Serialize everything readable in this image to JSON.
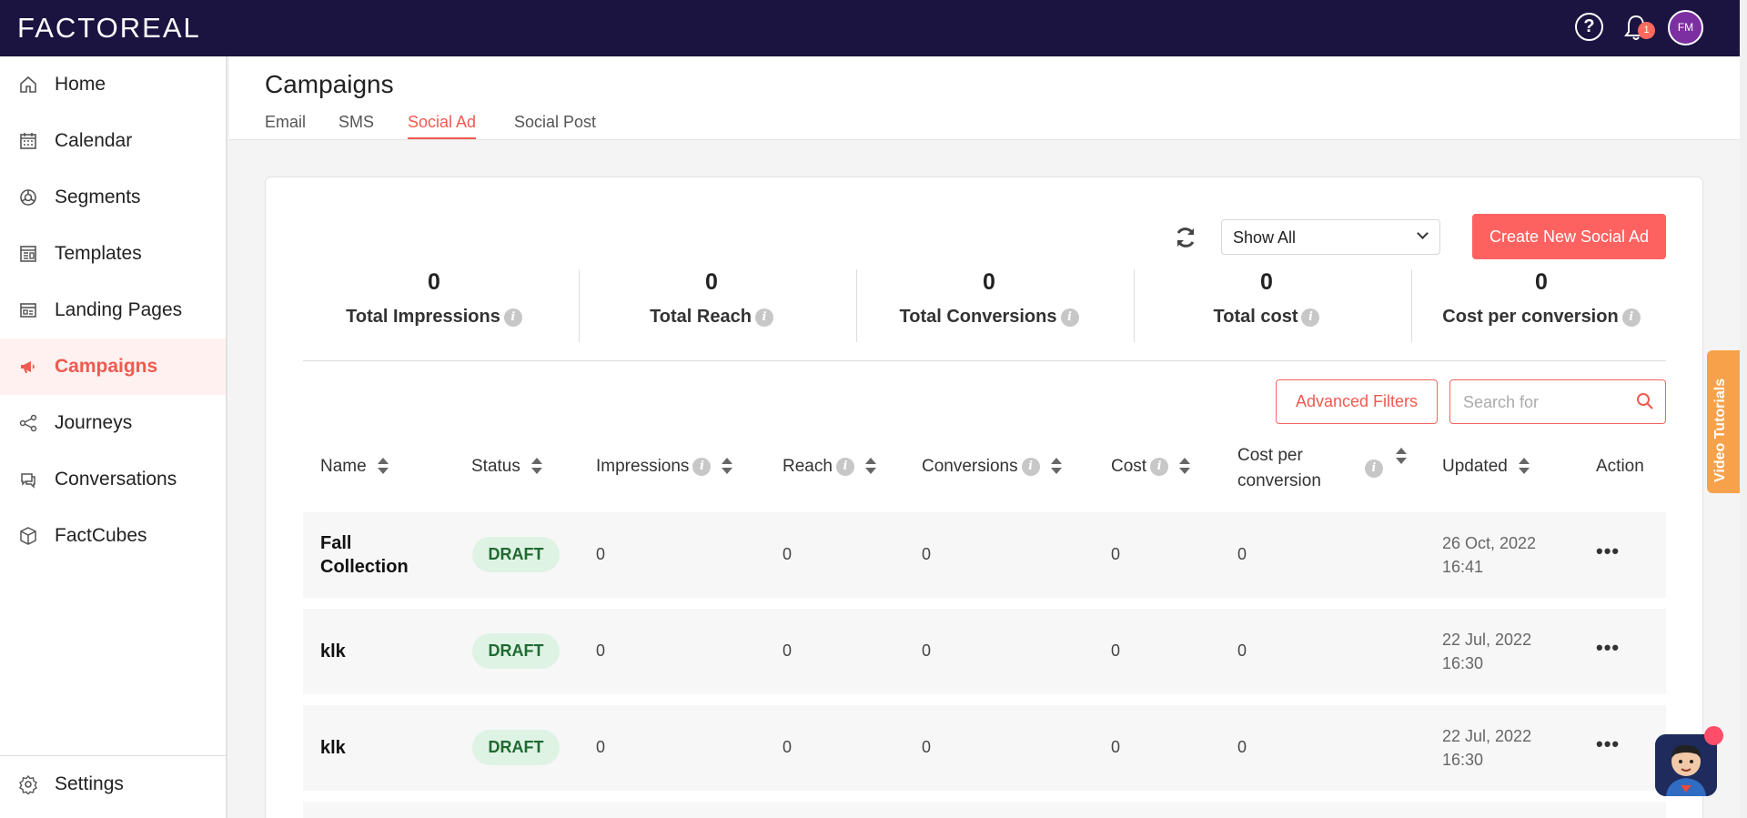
{
  "app": {
    "logo_text": "FACTOREAL",
    "notification_count": "1",
    "avatar_initials": "FM",
    "help_icon": "?"
  },
  "sidebar": {
    "items": [
      {
        "label": "Home",
        "icon": "home-icon"
      },
      {
        "label": "Calendar",
        "icon": "calendar-icon"
      },
      {
        "label": "Segments",
        "icon": "segments-icon"
      },
      {
        "label": "Templates",
        "icon": "templates-icon"
      },
      {
        "label": "Landing Pages",
        "icon": "landing-pages-icon"
      },
      {
        "label": "Campaigns",
        "icon": "megaphone-icon",
        "active": true
      },
      {
        "label": "Journeys",
        "icon": "share-icon"
      },
      {
        "label": "Conversations",
        "icon": "chat-icon"
      },
      {
        "label": "FactCubes",
        "icon": "cube-icon"
      }
    ],
    "settings_label": "Settings"
  },
  "header": {
    "title": "Campaigns",
    "tabs": [
      "Email",
      "SMS",
      "Social Ad",
      "Social Post"
    ],
    "active_tab": "Social Ad"
  },
  "toolbar": {
    "filter_value": "Show All",
    "create_label": "Create New Social Ad",
    "advanced_filters_label": "Advanced Filters",
    "search_placeholder": "Search for"
  },
  "stats": [
    {
      "value": "0",
      "label": "Total Impressions"
    },
    {
      "value": "0",
      "label": "Total Reach"
    },
    {
      "value": "0",
      "label": "Total Conversions"
    },
    {
      "value": "0",
      "label": "Total cost"
    },
    {
      "value": "0",
      "label": "Cost per conversion"
    }
  ],
  "table": {
    "columns": {
      "name": "Name",
      "status": "Status",
      "impressions": "Impressions",
      "reach": "Reach",
      "conversions": "Conversions",
      "cost": "Cost",
      "cost_per_conv_1": "Cost per",
      "cost_per_conv_2": "conversion",
      "updated": "Updated",
      "action": "Action"
    },
    "rows": [
      {
        "name_1": "Fall",
        "name_2": "Collection",
        "status": "DRAFT",
        "impressions": "0",
        "reach": "0",
        "conversions": "0",
        "cost": "0",
        "cpc": "0",
        "date_1": "26 Oct, 2022",
        "date_2": "16:41",
        "action": "•••"
      },
      {
        "name_1": "klk",
        "name_2": "",
        "status": "DRAFT",
        "impressions": "0",
        "reach": "0",
        "conversions": "0",
        "cost": "0",
        "cpc": "0",
        "date_1": "22 Jul, 2022",
        "date_2": "16:30",
        "action": "•••"
      },
      {
        "name_1": "klk",
        "name_2": "",
        "status": "DRAFT",
        "impressions": "0",
        "reach": "0",
        "conversions": "0",
        "cost": "0",
        "cpc": "0",
        "date_1": "22 Jul, 2022",
        "date_2": "16:30",
        "action": "•••"
      }
    ]
  },
  "side_tab": {
    "label": "Video Tutorials"
  },
  "colors": {
    "topbar": "#1b1340",
    "accent": "#f05a50",
    "create_button": "#fe6260",
    "draft_badge_bg": "#dff3e4",
    "video_tab": "#f7a24a"
  }
}
